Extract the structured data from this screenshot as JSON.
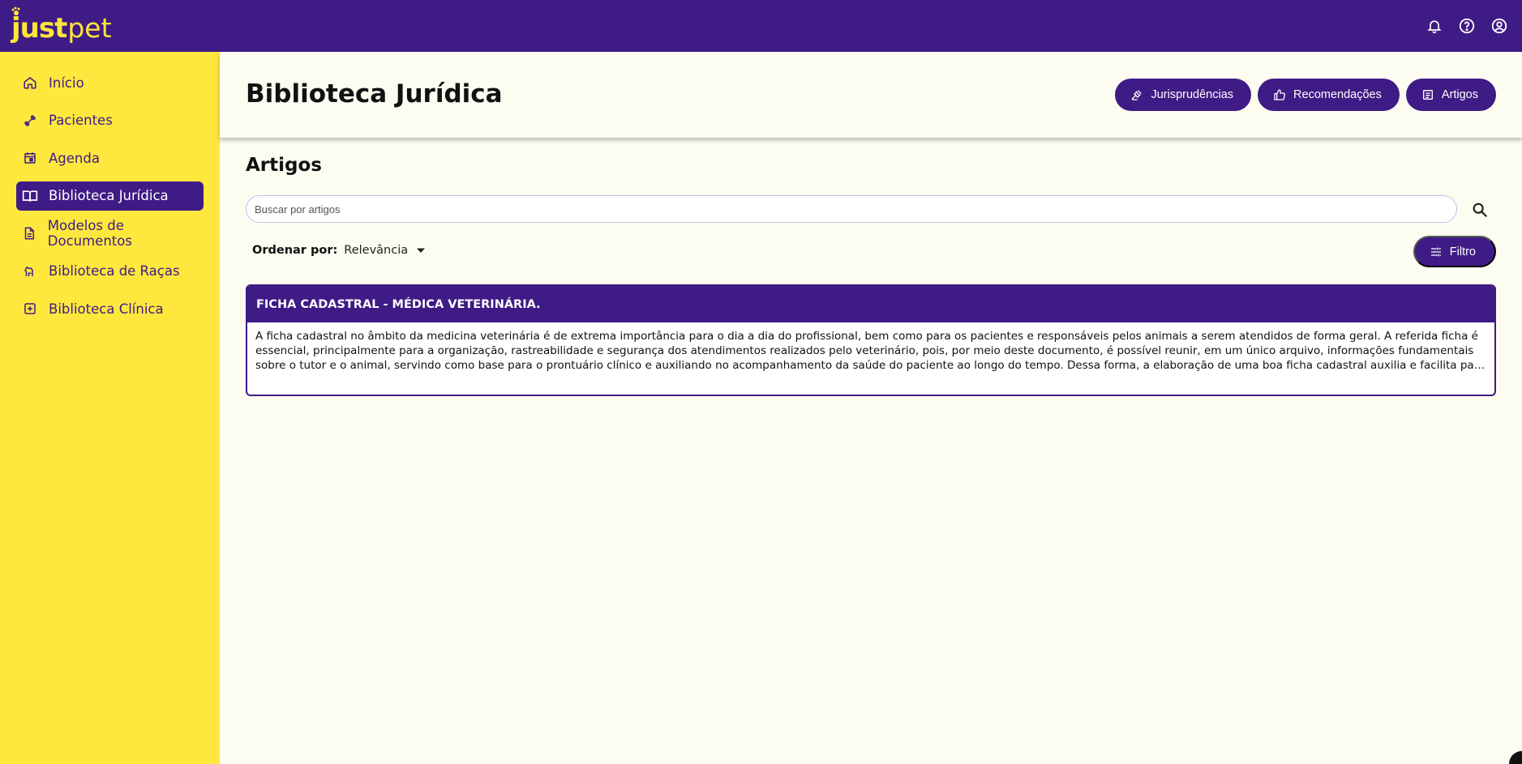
{
  "brand": {
    "part1": "just",
    "part2": "pet"
  },
  "colors": {
    "primary": "#3f1b85",
    "accent": "#ffe83d",
    "background": "#fdfcf0"
  },
  "topbar": {
    "icons": [
      "bell-icon",
      "help-icon",
      "account-icon"
    ]
  },
  "sidebar": {
    "items": [
      {
        "label": "Início",
        "icon": "home-icon"
      },
      {
        "label": "Pacientes",
        "icon": "bone-icon"
      },
      {
        "label": "Agenda",
        "icon": "calendar-icon"
      },
      {
        "label": "Biblioteca Jurídica",
        "icon": "book-open-icon",
        "active": true
      },
      {
        "label": "Modelos de Documentos",
        "icon": "document-icon"
      },
      {
        "label": "Biblioteca de Raças",
        "icon": "dog-icon"
      },
      {
        "label": "Biblioteca Clínica",
        "icon": "plus-box-icon"
      }
    ]
  },
  "header": {
    "title": "Biblioteca Jurídica",
    "buttons": [
      {
        "label": "Jurisprudências",
        "icon": "gavel-icon"
      },
      {
        "label": "Recomendações",
        "icon": "thumb-up-icon"
      },
      {
        "label": "Artigos",
        "icon": "article-icon"
      }
    ]
  },
  "main": {
    "section_title": "Artigos",
    "search": {
      "placeholder": "Buscar por artigos",
      "value": ""
    },
    "sort": {
      "label": "Ordenar por:",
      "value": "Relevância"
    },
    "filter_label": "Filtro",
    "articles": [
      {
        "title": "FICHA CADASTRAL - MÉDICA VETERINÁRIA.",
        "excerpt": "A ficha cadastral no âmbito da medicina veterinária é de extrema importância para o dia a dia do profissional, bem como para os pacientes e responsáveis pelos animais a serem atendidos de forma geral. A referida ficha é essencial, principalmente para a organização, rastreabilidade e segurança dos atendimentos realizados pelo veterinário, pois, por meio deste documento, é possível reunir, em um único arquivo, informações fundamentais sobre o tutor e o animal, servindo como base para o prontuário clínico e auxiliando no acompanhamento da saúde do paciente ao longo do tempo. Dessa forma, a elaboração de uma boa ficha cadastral auxilia e facilita para que o profissional tenha acesso rápido e organizado às informações necessárias."
      }
    ]
  }
}
